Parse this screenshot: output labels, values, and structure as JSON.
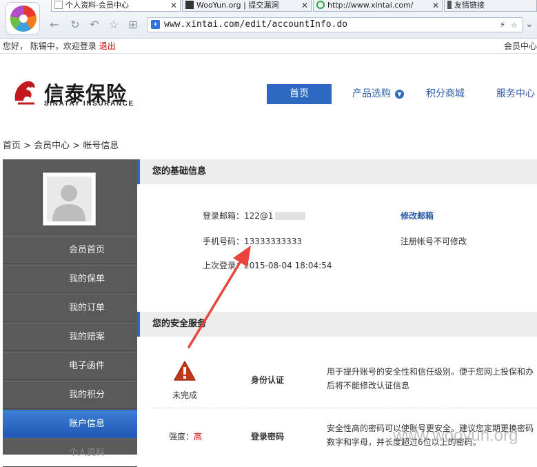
{
  "browser": {
    "tabs": [
      {
        "label": "个人资料-会员中心",
        "close": "✕"
      },
      {
        "label": "WooYun.org | 提交漏洞",
        "close": "✕"
      },
      {
        "label": "http://www.xintai.com/",
        "close": "✕"
      },
      {
        "label": "友情链接",
        "close": ""
      }
    ],
    "url": "www.xintai.com/edit/accountInfo.do"
  },
  "topbar": {
    "greeting_prefix": "您好，",
    "username": "陈锡中",
    "greeting_suffix": "，欢迎登录",
    "logout": "退出",
    "member_center": "会员中心"
  },
  "header": {
    "brand_cn": "信泰保险",
    "brand_en": "SINATAY INSURANCE",
    "nav": [
      "首页",
      "产品选购",
      "积分商城",
      "服务中心"
    ]
  },
  "breadcrumb": "首页 > 会员中心 > 帐号信息",
  "sidebar": {
    "items": [
      "会员首页",
      "我的保单",
      "我的订单",
      "我的赔案",
      "电子函件",
      "我的积分",
      "账户信息",
      "个人资料"
    ],
    "active_index": 6
  },
  "basic_info": {
    "title": "您的基础信息",
    "email_label": "登录邮箱：",
    "email_value": "122@1",
    "change_email": "修改邮箱",
    "phone_label": "手机号码：",
    "phone_value": "13333333333",
    "phone_note": "注册帐号不可修改",
    "last_login_label": "上次登录：",
    "last_login_value": "2015-08-04 18:04:54"
  },
  "security": {
    "title": "您的安全服务",
    "identity": {
      "status": "未完成",
      "title": "身份认证",
      "desc_line1": "用于提升账号的安全性和信任级别。便于您网上投保和办",
      "desc_line2": "后将不能修改认证信息"
    },
    "password": {
      "strength_label": "强度：",
      "strength_value": "高",
      "title": "登录密码",
      "desc_line1": "安全性高的密码可以使账号更安全。建议您定期更换密码",
      "desc_line2": "数字和字母，并长度超过6位以上的密码。"
    }
  },
  "watermark": "www.wooyun.org",
  "colors": {
    "accent": "#2e69c1",
    "sidebar": "#5a5a5a",
    "arrow": "#e8453c",
    "warning": "#c0391b"
  }
}
